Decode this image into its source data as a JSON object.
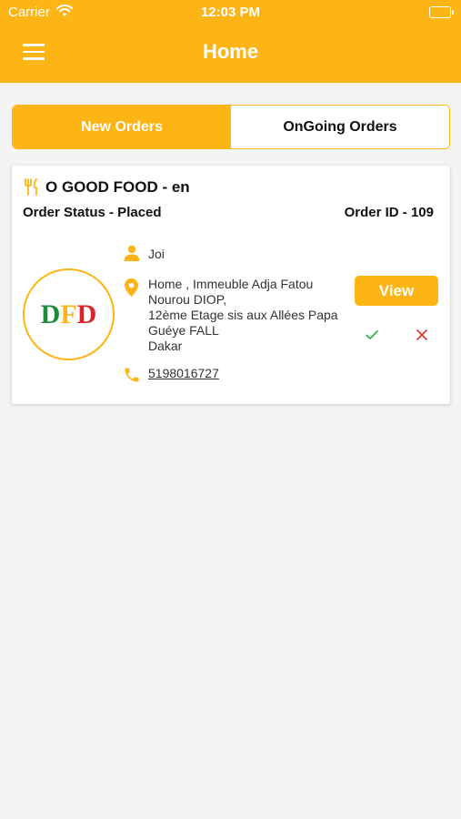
{
  "status_bar": {
    "carrier": "Carrier",
    "time": "12:03 PM"
  },
  "header": {
    "title": "Home",
    "menu_icon": "hamburger-menu-icon",
    "color": "#fdb515"
  },
  "tabs": [
    {
      "label": "New Orders",
      "active": true
    },
    {
      "label": "OnGoing Orders",
      "active": false
    }
  ],
  "order": {
    "restaurant_name": "O GOOD FOOD - en",
    "status": "Order Status - Placed",
    "order_id": "Order ID - 109",
    "logo": {
      "l1": "D",
      "l2": "F",
      "l3": "D"
    },
    "customer_name": "Joi",
    "address_lines": [
      "Home , Immeuble Adja Fatou",
      "Nourou DIOP,",
      "12ème Etage sis aux Allées Papa",
      "Guéye FALL",
      "Dakar"
    ],
    "phone": "5198016727",
    "view_label": "View",
    "accept_icon": "checkmark-icon",
    "reject_icon": "close-icon"
  }
}
